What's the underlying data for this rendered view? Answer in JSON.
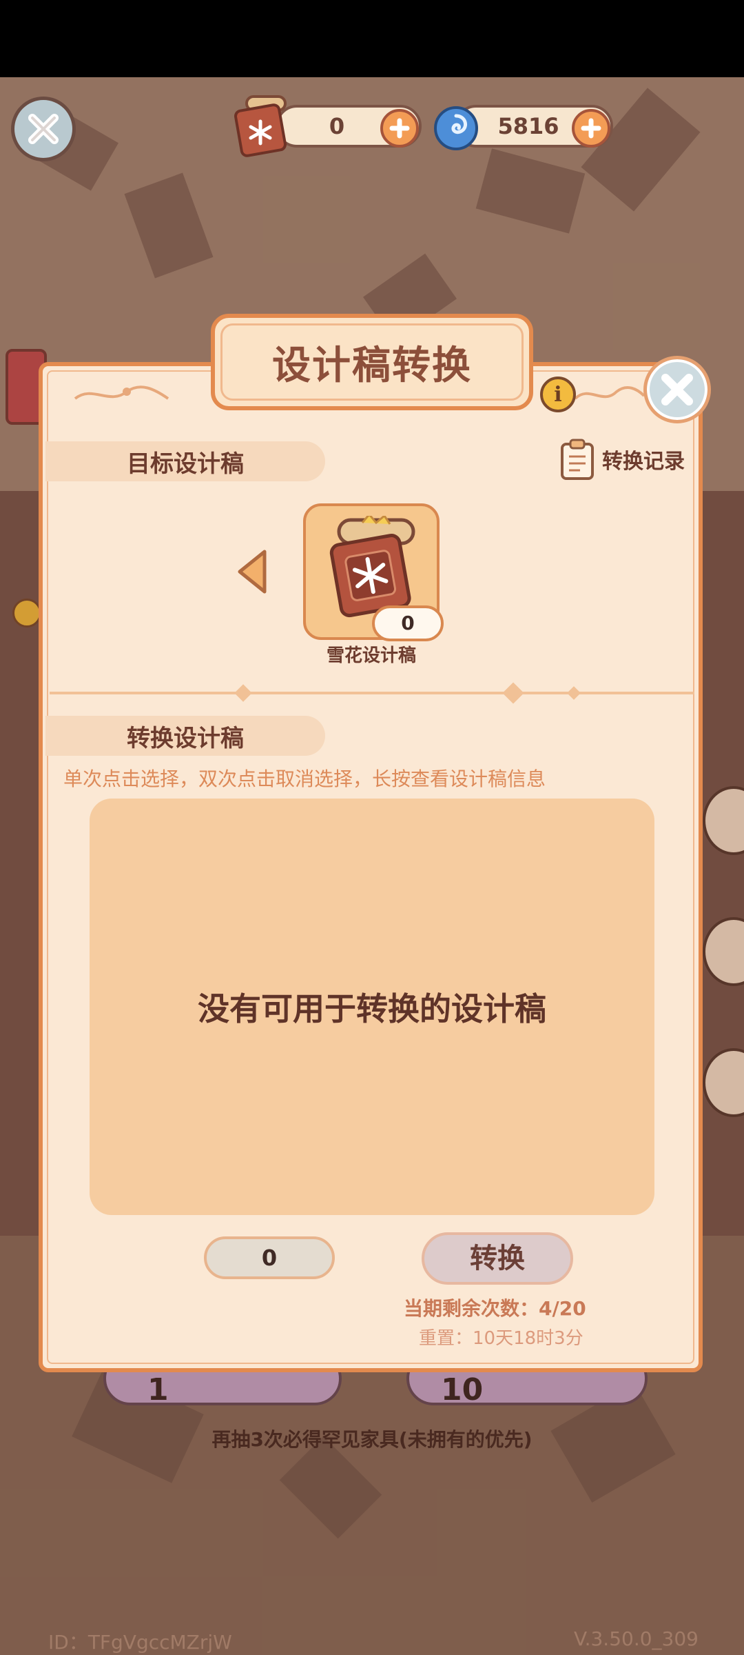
{
  "hud": {
    "scroll_count": "0",
    "swirl_count": "5816"
  },
  "dialog": {
    "title": "设计稿转换",
    "target_section_label": "目标设计稿",
    "record_label": "转换记录",
    "item": {
      "count": "0",
      "name": "雪花设计稿"
    },
    "convert_section_label": "转换设计稿",
    "hint": "单次点击选择，双次点击取消选择，长按查看设计稿信息",
    "empty_message": "没有可用于转换的设计稿",
    "selected_count": "0",
    "convert_button": "转换",
    "remaining": "当期剩余次数：4/20",
    "reset": "重置：10天18时3分"
  },
  "background": {
    "draw_1_label": "1",
    "draw_10_label": "10",
    "pity_text": "再抽3次必得罕见家具(未拥有的优先)",
    "player_id": "ID：TFgVgccMZrjW",
    "version": "V.3.50.0_309"
  },
  "colors": {
    "accent": "#e38a4e",
    "panel": "#fbe8d4",
    "text_dark": "#6d3c2e",
    "plus": "#f39c55"
  }
}
